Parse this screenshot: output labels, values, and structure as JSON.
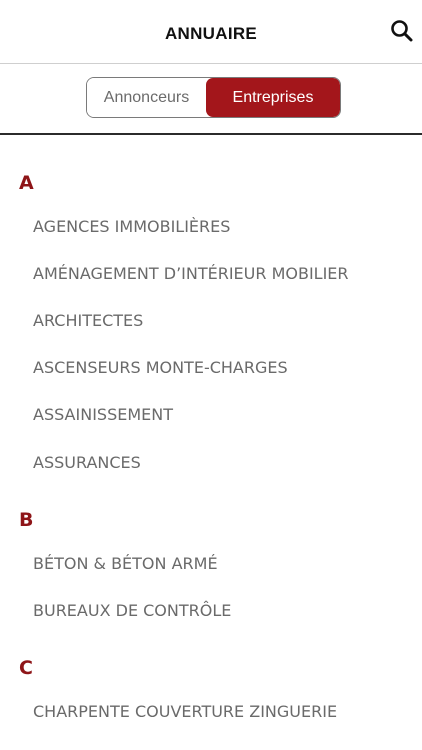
{
  "header": {
    "title": "ANNUAIRE",
    "search_icon": "search-icon"
  },
  "segments": {
    "left_label": "Annonceurs",
    "right_label": "Entreprises",
    "active": "Entreprises",
    "active_color": "#a3161b"
  },
  "colors": {
    "section_letter": "#8e1518",
    "item_text": "#6a6a6a"
  },
  "sections": [
    {
      "letter": "A",
      "items": [
        "AGENCES IMMOBILIÈRES",
        "AMÉNAGEMENT D’INTÉRIEUR MOBILIER",
        "ARCHITECTES",
        "ASCENSEURS MONTE-CHARGES",
        "ASSAINISSEMENT",
        "ASSURANCES"
      ]
    },
    {
      "letter": "B",
      "items": [
        "BÉTON & BÉTON ARMÉ",
        "BUREAUX DE CONTRÔLE"
      ]
    },
    {
      "letter": "C",
      "items": [
        "CHARPENTE COUVERTURE ZINGUERIE"
      ]
    }
  ]
}
